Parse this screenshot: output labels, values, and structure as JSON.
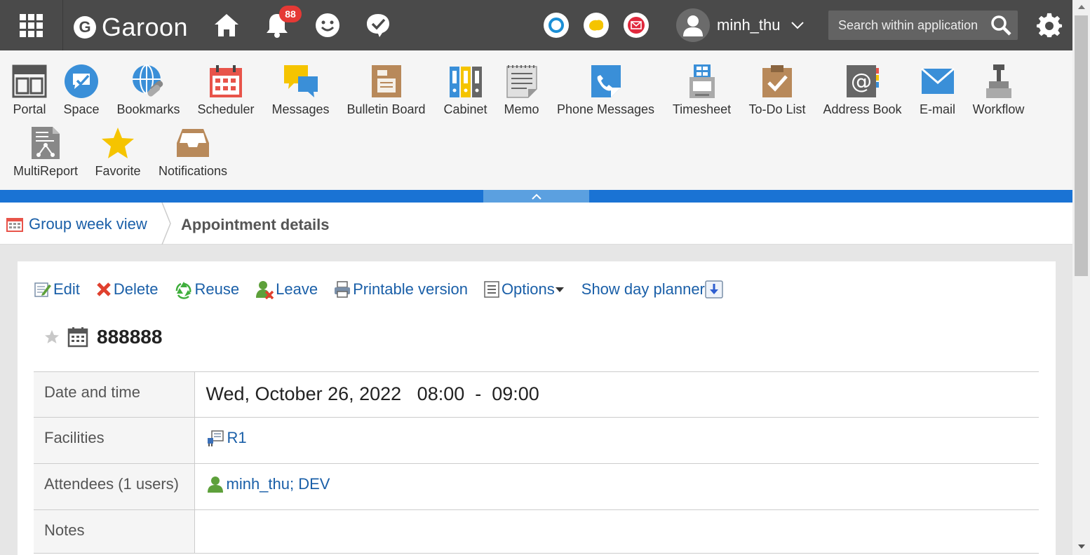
{
  "header": {
    "app_name": "Garoon",
    "logo_letter": "G",
    "notification_count": "88",
    "user_name": "minh_thu",
    "search_placeholder": "Search within application"
  },
  "apps": [
    {
      "label": "Portal",
      "icon": "portal-icon"
    },
    {
      "label": "Space",
      "icon": "space-icon"
    },
    {
      "label": "Bookmarks",
      "icon": "bookmarks-icon"
    },
    {
      "label": "Scheduler",
      "icon": "scheduler-icon"
    },
    {
      "label": "Messages",
      "icon": "messages-icon"
    },
    {
      "label": "Bulletin Board",
      "icon": "bulletin-board-icon"
    },
    {
      "label": "Cabinet",
      "icon": "cabinet-icon"
    },
    {
      "label": "Memo",
      "icon": "memo-icon"
    },
    {
      "label": "Phone Messages",
      "icon": "phone-messages-icon"
    },
    {
      "label": "Timesheet",
      "icon": "timesheet-icon"
    },
    {
      "label": "To-Do List",
      "icon": "todo-list-icon"
    },
    {
      "label": "Address Book",
      "icon": "address-book-icon"
    },
    {
      "label": "E-mail",
      "icon": "email-icon"
    },
    {
      "label": "Workflow",
      "icon": "workflow-icon"
    },
    {
      "label": "MultiReport",
      "icon": "multireport-icon"
    },
    {
      "label": "Favorite",
      "icon": "favorite-icon"
    },
    {
      "label": "Notifications",
      "icon": "notifications-icon"
    }
  ],
  "breadcrumb": {
    "parent": "Group week view",
    "current": "Appointment details"
  },
  "toolbar": {
    "edit": "Edit",
    "delete": "Delete",
    "reuse": "Reuse",
    "leave": "Leave",
    "printable": "Printable version",
    "options": "Options",
    "day_planner": "Show day planner"
  },
  "appointment": {
    "title": "888888",
    "rows": {
      "date_label": "Date and time",
      "date_value": "Wed, October 26, 2022   08:00  -  09:00",
      "facilities_label": "Facilities",
      "facilities_value": "R1",
      "attendees_label": "Attendees (1 users)",
      "attendees_value": "minh_thu; DEV",
      "notes_label": "Notes",
      "notes_value": ""
    }
  },
  "colors": {
    "header_bg": "#4a4a4a",
    "link": "#1a5fa8",
    "accent_blue": "#1a73d4",
    "badge": "#e53935"
  }
}
